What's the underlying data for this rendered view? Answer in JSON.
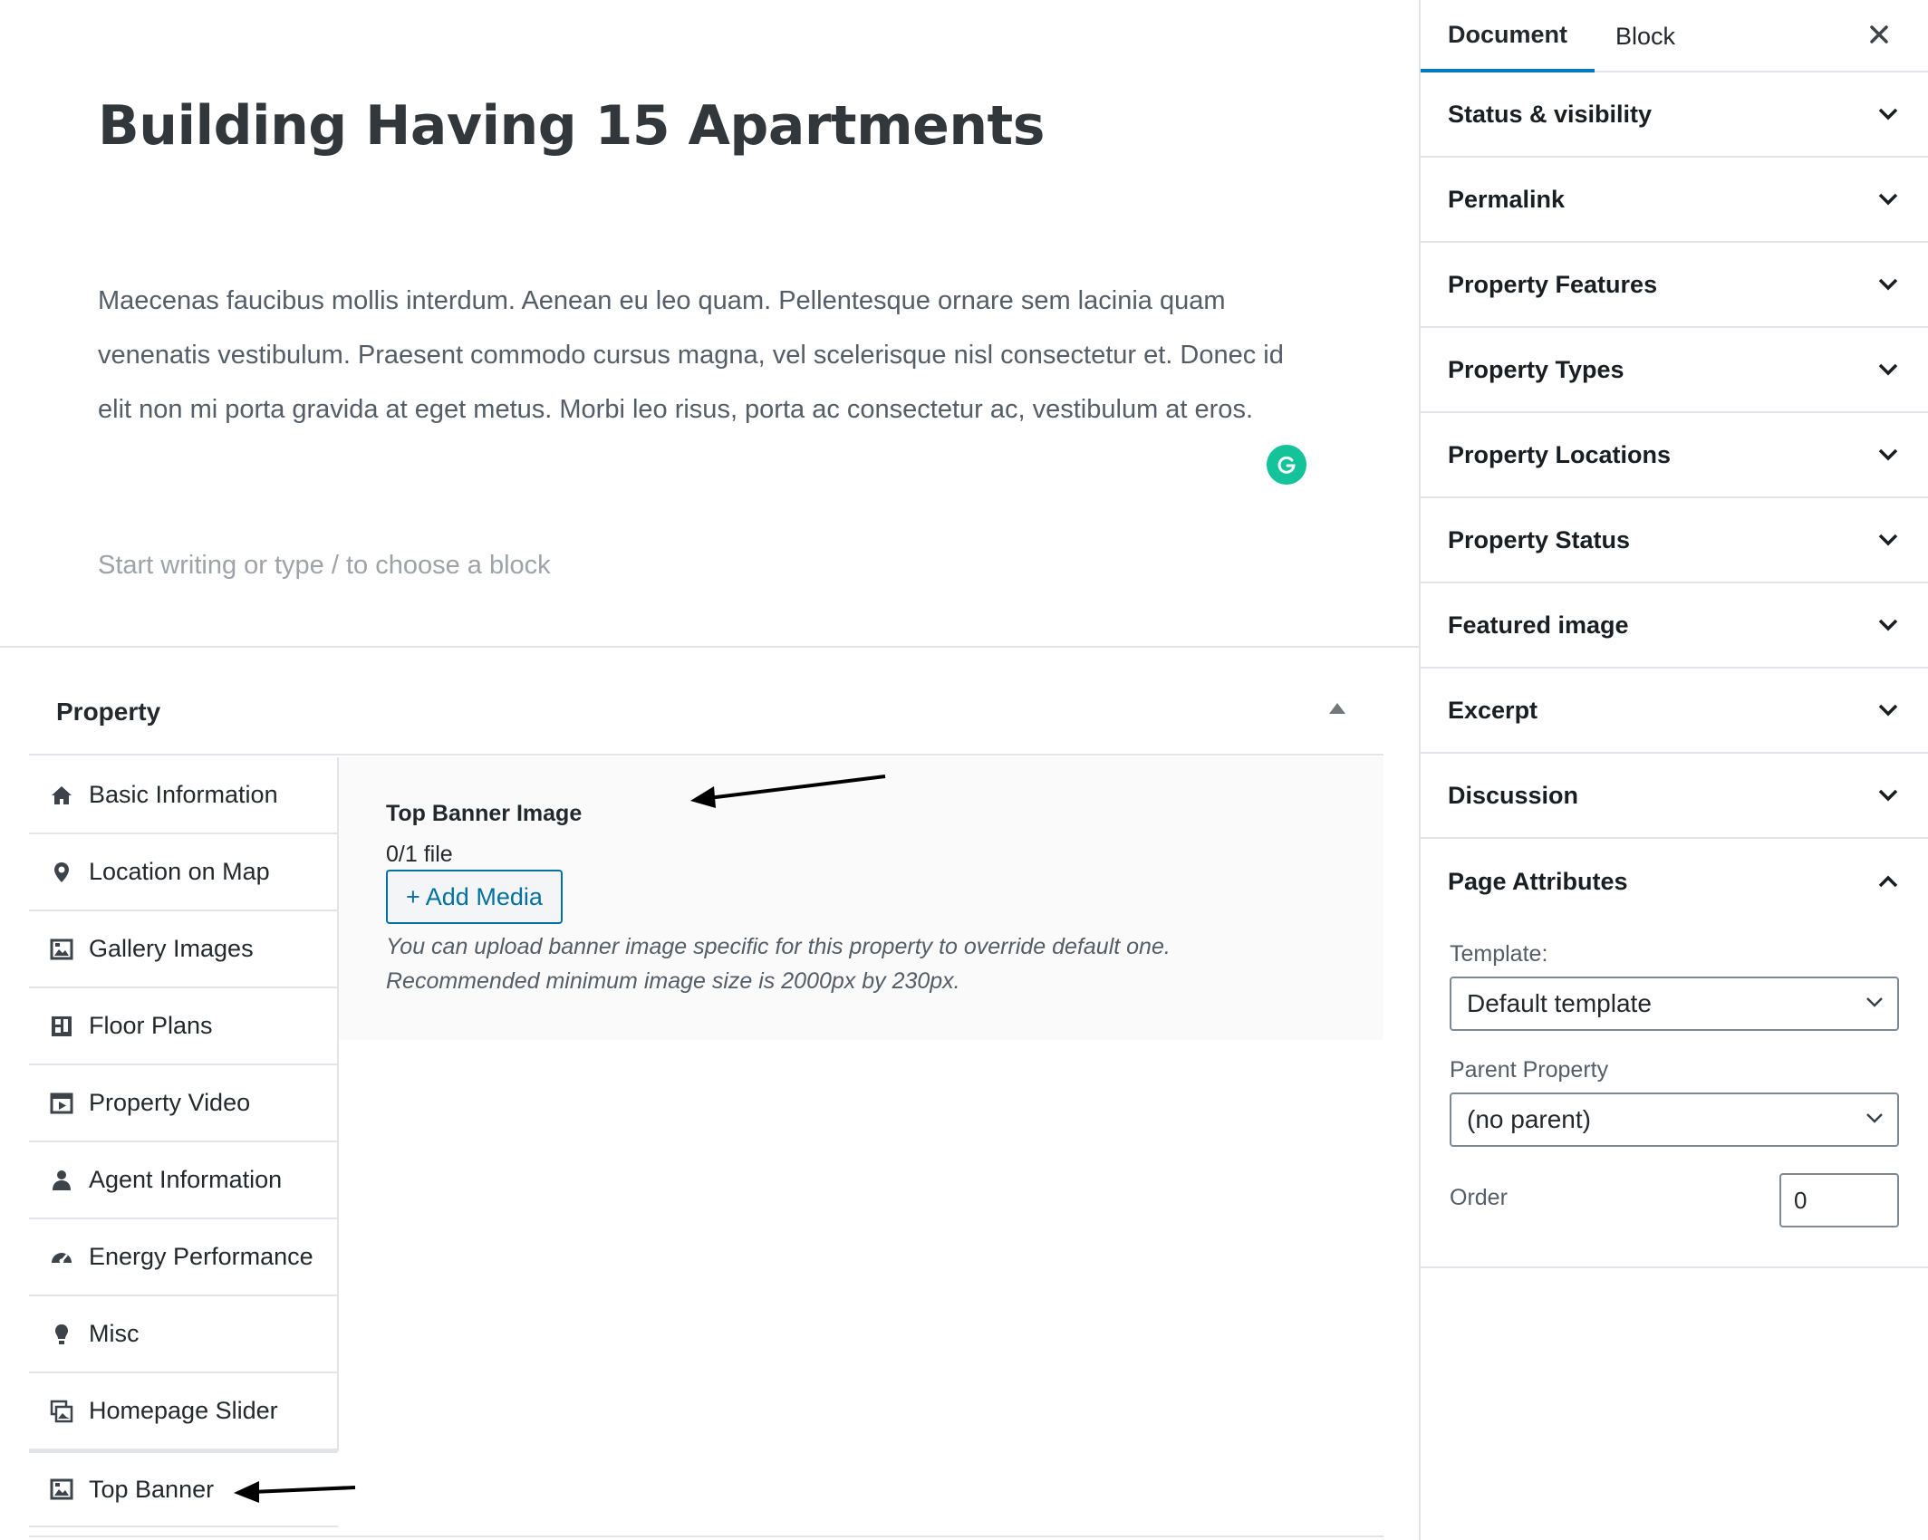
{
  "editor": {
    "title": "Building Having 15 Apartments",
    "paragraph": "Maecenas faucibus mollis interdum. Aenean eu leo quam. Pellentesque ornare sem lacinia quam venenatis vestibulum. Praesent commodo cursus magna, vel scelerisque nisl consectetur et. Donec id elit non mi porta gravida at eget metus. Morbi leo risus, porta ac consectetur ac, vestibulum at eros.",
    "placeholder": "Start writing or type / to choose a block"
  },
  "metabox": {
    "title": "Property",
    "tabs": [
      {
        "label": "Basic Information",
        "icon": "home-icon"
      },
      {
        "label": "Location on Map",
        "icon": "location-pin-icon"
      },
      {
        "label": "Gallery Images",
        "icon": "gallery-icon"
      },
      {
        "label": "Floor Plans",
        "icon": "floor-plan-icon"
      },
      {
        "label": "Property Video",
        "icon": "video-icon"
      },
      {
        "label": "Agent Information",
        "icon": "agent-icon"
      },
      {
        "label": "Energy Performance",
        "icon": "dashboard-icon"
      },
      {
        "label": "Misc",
        "icon": "lightbulb-icon"
      },
      {
        "label": "Homepage Slider",
        "icon": "slider-icon"
      },
      {
        "label": "Top Banner",
        "icon": "image-icon"
      }
    ],
    "active_tab": "Top Banner",
    "panel": {
      "field_title": "Top Banner Image",
      "file_count": "0/1 file",
      "add_media_label": "+ Add Media",
      "description_line1": "You can upload banner image specific for this property to override default one.",
      "description_line2": "Recommended minimum image size is 2000px by 230px."
    }
  },
  "sidebar": {
    "tabs": {
      "document": "Document",
      "block": "Block"
    },
    "panels": [
      "Status & visibility",
      "Permalink",
      "Property Features",
      "Property Types",
      "Property Locations",
      "Property Status",
      "Featured image",
      "Excerpt",
      "Discussion"
    ],
    "page_attributes": {
      "title": "Page Attributes",
      "template_label": "Template:",
      "template_value": "Default template",
      "parent_label": "Parent Property",
      "parent_value": "(no parent)",
      "order_label": "Order",
      "order_value": "0"
    }
  },
  "colors": {
    "accent": "#007cba",
    "grammarly": "#15c39a",
    "button_blue": "#0071a1"
  }
}
